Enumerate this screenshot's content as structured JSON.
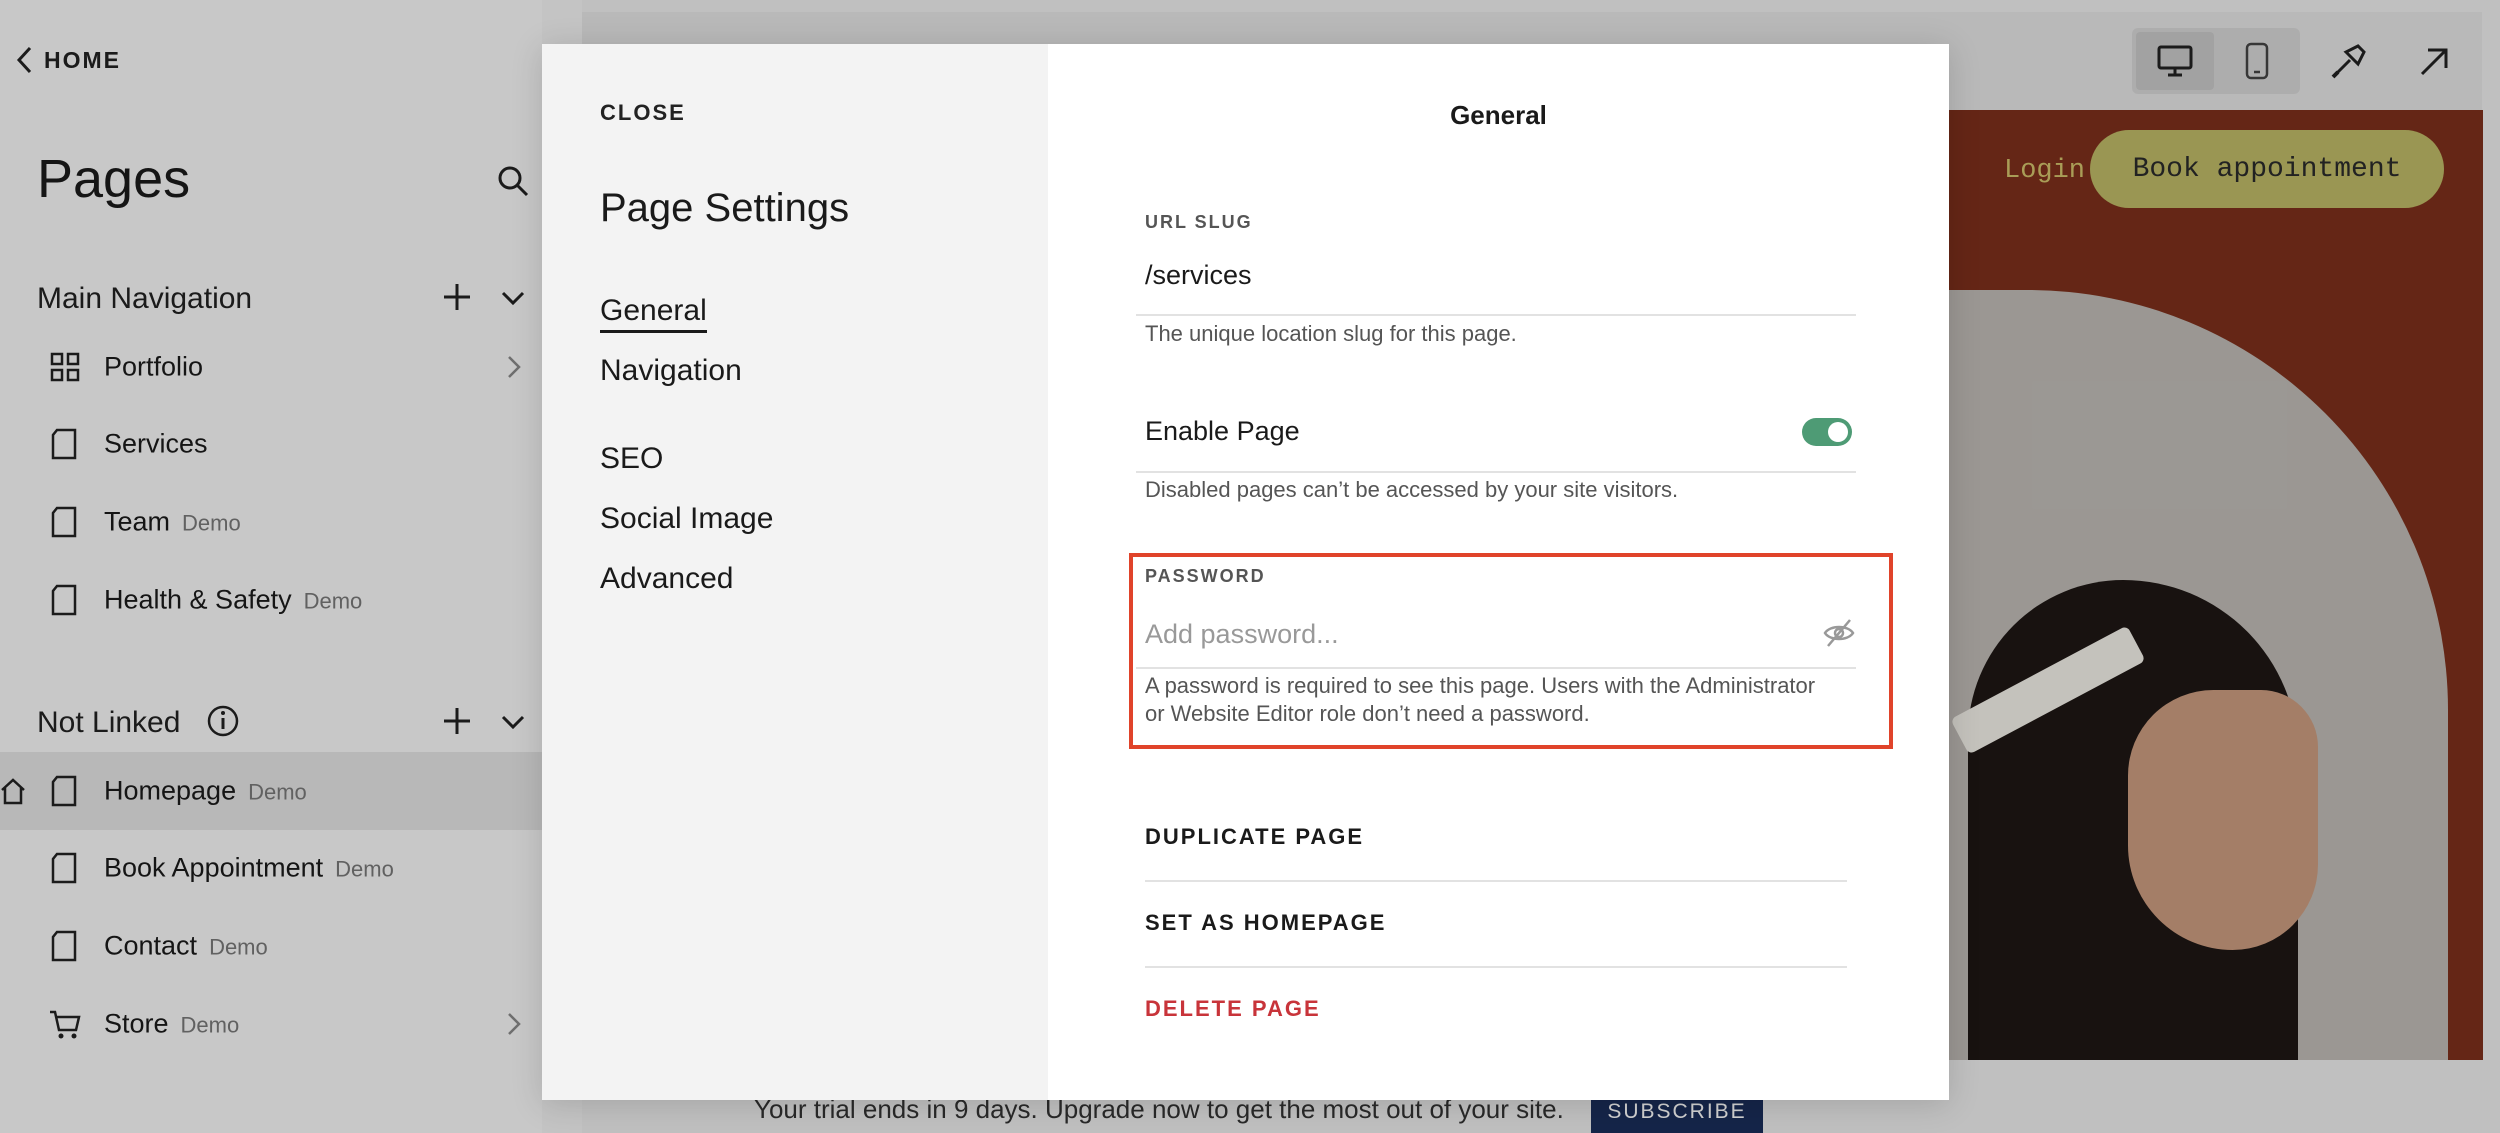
{
  "sidebar": {
    "home_label": "HOME",
    "title": "Pages",
    "main_nav": {
      "title": "Main Navigation",
      "items": [
        {
          "label": "Portfolio",
          "tag": ""
        },
        {
          "label": "Services",
          "tag": ""
        },
        {
          "label": "Team",
          "tag": "Demo"
        },
        {
          "label": "Health & Safety",
          "tag": "Demo"
        }
      ]
    },
    "not_linked": {
      "title": "Not Linked",
      "items": [
        {
          "label": "Homepage",
          "tag": "Demo"
        },
        {
          "label": "Book Appointment",
          "tag": "Demo"
        },
        {
          "label": "Contact",
          "tag": "Demo"
        },
        {
          "label": "Store",
          "tag": "Demo"
        }
      ]
    }
  },
  "preview": {
    "login": "Login",
    "book_button": "Book appointment",
    "trial_message": "Your trial ends in 9 days. Upgrade now to get the most out of your site.",
    "subscribe": "SUBSCRIBE"
  },
  "modal": {
    "close": "CLOSE",
    "title": "Page Settings",
    "menu": [
      "General",
      "Navigation",
      "SEO",
      "Social Image",
      "Advanced"
    ],
    "active_menu": "General",
    "panel_title": "General",
    "url_slug": {
      "label": "URL SLUG",
      "value": "/services",
      "help": "The unique location slug for this page."
    },
    "enable_page": {
      "label": "Enable Page",
      "enabled": true,
      "help": "Disabled pages can’t be accessed by your site visitors."
    },
    "password": {
      "label": "PASSWORD",
      "placeholder": "Add password...",
      "help_line1": "A password is required to see this page. Users with the Administrator",
      "help_line2": "or Website Editor role don’t need a password."
    },
    "actions": {
      "duplicate": "DUPLICATE PAGE",
      "set_homepage": "SET AS HOMEPAGE",
      "delete": "DELETE PAGE"
    }
  },
  "colors": {
    "toggle_on": "#4e9b75",
    "highlight": "#e0432a",
    "danger": "#c8343a",
    "site_bg": "#7c2f1b",
    "book_btn": "#bcb866"
  }
}
